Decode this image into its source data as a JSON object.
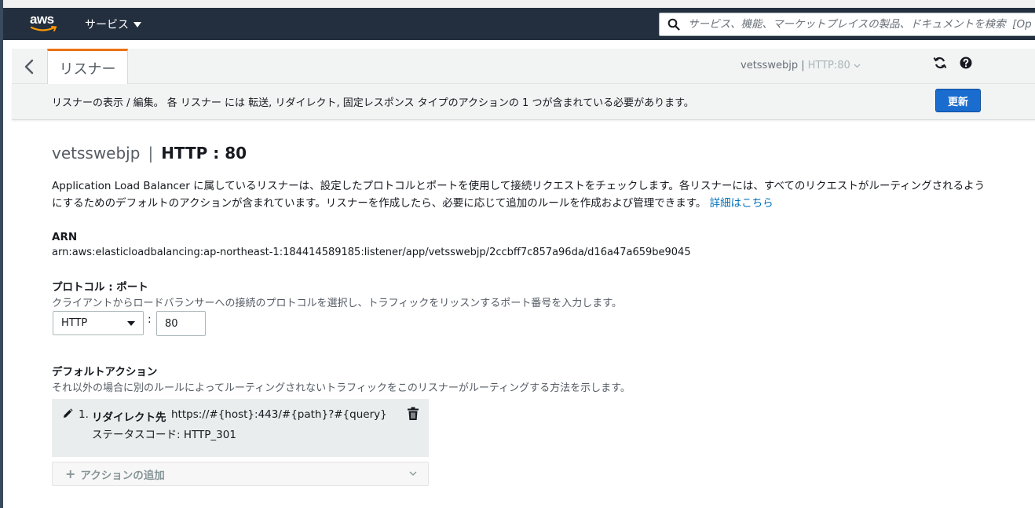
{
  "nav": {
    "logo": "aws",
    "services_label": "サービス",
    "search_placeholder": "サービス、機能、マーケットプレイスの製品、ドキュメントを検索  [Op"
  },
  "tabs": {
    "active_label": "リスナー",
    "listener_lb": "vetsswebjp |",
    "listener_proto": "HTTP:80"
  },
  "info_bar": {
    "message": "リスナーの表示 / 編集。 各 リスナー には 転送, リダイレクト, 固定レスポンス タイプのアクションの 1 つが含まれている必要があります。",
    "update_label": "更新"
  },
  "title": {
    "lb_name": "vetsswebjp",
    "separator": "|",
    "listener": "HTTP : 80"
  },
  "description": {
    "text": "Application Load Balancer に属しているリスナーは、設定したプロトコルとポートを使用して接続リクエストをチェックします。各リスナーには、すべてのリクエストがルーティングされるようにするためのデフォルトのアクションが含まれています。リスナーを作成したら、必要に応じて追加のルールを作成および管理できます。",
    "link": "詳細はこちら"
  },
  "arn": {
    "label": "ARN",
    "value": "arn:aws:elasticloadbalancing:ap-northeast-1:184414589185:listener/app/vetsswebjp/2ccbff7c857a96da/d16a47a659be9045"
  },
  "protocol_port": {
    "label": "プロトコル : ポート",
    "help": "クライアントからロードバランサーへの接続のプロトコルを選択し、トラフィックをリッスンするポート番号を入力します。",
    "protocol": "HTTP",
    "colon": ":",
    "port": "80"
  },
  "default_action": {
    "label": "デフォルトアクション",
    "help": "それ以外の場合に別のルールによってルーティングされないトラフィックをこのリスナーがルーティングする方法を示します。",
    "actions": [
      {
        "num": "1.",
        "type": "リダイレクト先",
        "url": "https://#{host}:443/#{path}?#{query}",
        "status": "ステータスコード: HTTP_301"
      }
    ],
    "add_label": "アクションの追加"
  }
}
